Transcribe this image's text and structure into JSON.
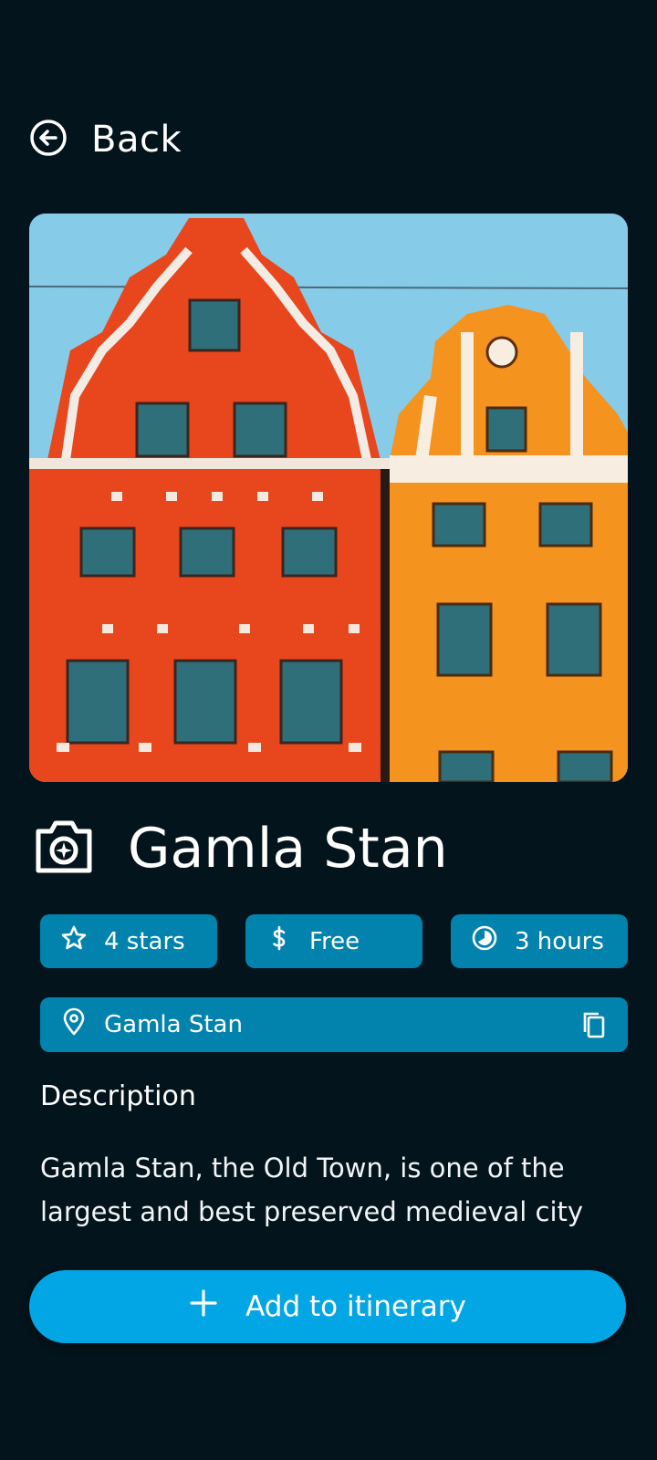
{
  "header": {
    "back_label": "Back"
  },
  "hero": {
    "image_description": "Colorful old buildings of Gamla Stan"
  },
  "place": {
    "name": "Gamla Stan",
    "rating": "4 stars",
    "price": "Free",
    "duration": "3 hours",
    "location": "Gamla Stan"
  },
  "description": {
    "heading": "Description",
    "text": "Gamla Stan, the Old Town, is one of the largest and best preserved medieval city"
  },
  "actions": {
    "add_label": "Add to itinerary"
  },
  "colors": {
    "background": "#04141c",
    "chip": "#0283ad",
    "accent": "#03a6e4"
  }
}
